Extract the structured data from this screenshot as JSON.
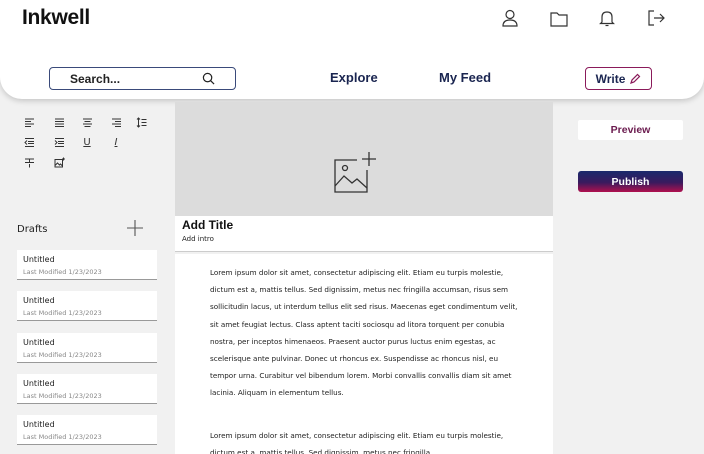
{
  "app": {
    "logo": "Inkwell"
  },
  "header": {
    "icons": [
      "user-icon",
      "folder-icon",
      "bell-icon",
      "logout-icon"
    ],
    "search_placeholder": "Search...",
    "nav": [
      "Explore",
      "My Feed"
    ],
    "write_label": "Write"
  },
  "colors": {
    "nav_text": "#1a2550",
    "accent": "#8a1a5a",
    "publish_gradient": [
      "#1a2a6c",
      "#b0104e"
    ]
  },
  "toolbar": {
    "tools": [
      "align-left-icon",
      "align-justify-icon",
      "align-center-icon",
      "align-right-icon",
      "line-height-icon",
      "outdent-icon",
      "indent-icon",
      "underline-icon",
      "italic-icon",
      "strikethrough-icon",
      "insert-image-icon"
    ],
    "underline": "U",
    "italic": "I"
  },
  "drafts": {
    "label": "Drafts",
    "items": [
      {
        "title": "Untitled",
        "modified": "Last Modified 1/23/2023"
      },
      {
        "title": "Untitled",
        "modified": "Last Modified 1/23/2023"
      },
      {
        "title": "Untitled",
        "modified": "Last Modified 1/23/2023"
      },
      {
        "title": "Untitled",
        "modified": "Last Modified 1/23/2023"
      },
      {
        "title": "Untitled",
        "modified": "Last Modified 1/23/2023"
      }
    ]
  },
  "editor": {
    "title_placeholder": "Add Title",
    "intro_placeholder": "Add intro",
    "paragraphs": [
      "Lorem ipsum dolor sit amet, consectetur adipiscing elit. Etiam eu turpis molestie, dictum est a, mattis tellus. Sed dignissim, metus nec fringilla accumsan, risus sem sollicitudin lacus, ut interdum tellus elit sed risus. Maecenas eget condimentum velit, sit amet feugiat lectus. Class aptent taciti sociosqu ad litora torquent per conubia nostra, per inceptos himenaeos. Praesent auctor purus luctus enim egestas, ac scelerisque ante pulvinar. Donec ut rhoncus ex. Suspendisse ac rhoncus nisl, eu tempor urna. Curabitur vel bibendum lorem. Morbi convallis convallis diam sit amet lacinia. Aliquam in elementum tellus.",
      "Lorem ipsum dolor sit amet, consectetur adipiscing elit. Etiam eu turpis molestie, dictum est a, mattis tellus. Sed dignissim, metus nec fringilla"
    ]
  },
  "actions": {
    "preview": "Preview",
    "publish": "Publish"
  }
}
